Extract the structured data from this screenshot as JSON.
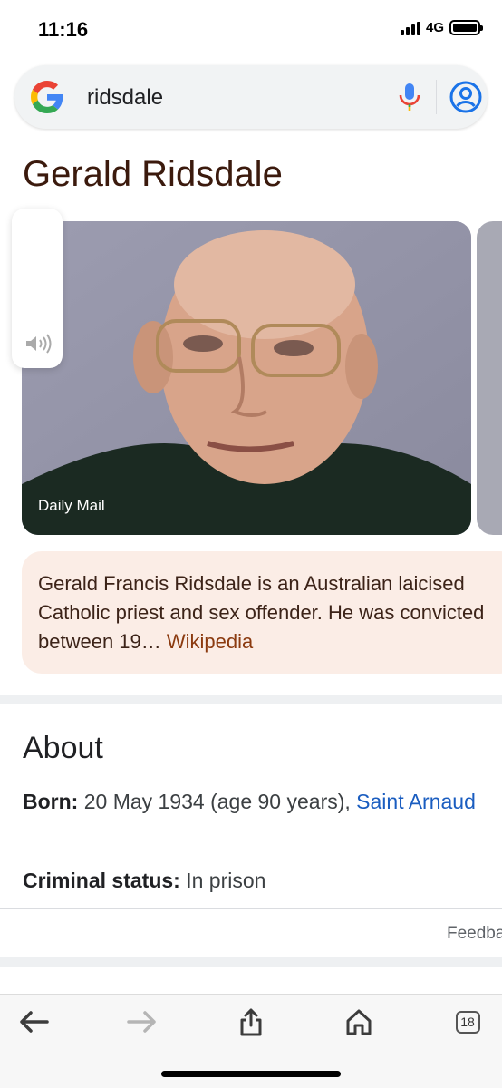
{
  "status_bar": {
    "time": "11:16",
    "network": "4G"
  },
  "search": {
    "query": "ridsdale"
  },
  "entity": {
    "title": "Gerald Ridsdale"
  },
  "image": {
    "source": "Daily Mail"
  },
  "description": {
    "text": "Gerald Francis Ridsdale is an Australian laicised Catholic priest and sex offender. He was convicted between 19…",
    "source_link": "Wikipedia"
  },
  "about": {
    "heading": "About",
    "born_label": "Born:",
    "born_value": "20 May 1934 (age 90 years),",
    "born_place": "Saint Arnaud",
    "status_label": "Criminal status:",
    "status_value": "In prison"
  },
  "feedback": {
    "label": "Feedback"
  },
  "bottom_bar": {
    "tab_count": "18"
  },
  "colors": {
    "title": "#3b1a0d",
    "description_bg": "#fbede6",
    "link_blue": "#1a5dc0",
    "wikipedia_link": "#8b3a0f"
  },
  "icons": [
    "google-logo-icon",
    "microphone-icon",
    "account-icon",
    "speaker-icon",
    "back-arrow-icon",
    "forward-arrow-icon",
    "share-icon",
    "home-icon",
    "tabs-icon"
  ]
}
